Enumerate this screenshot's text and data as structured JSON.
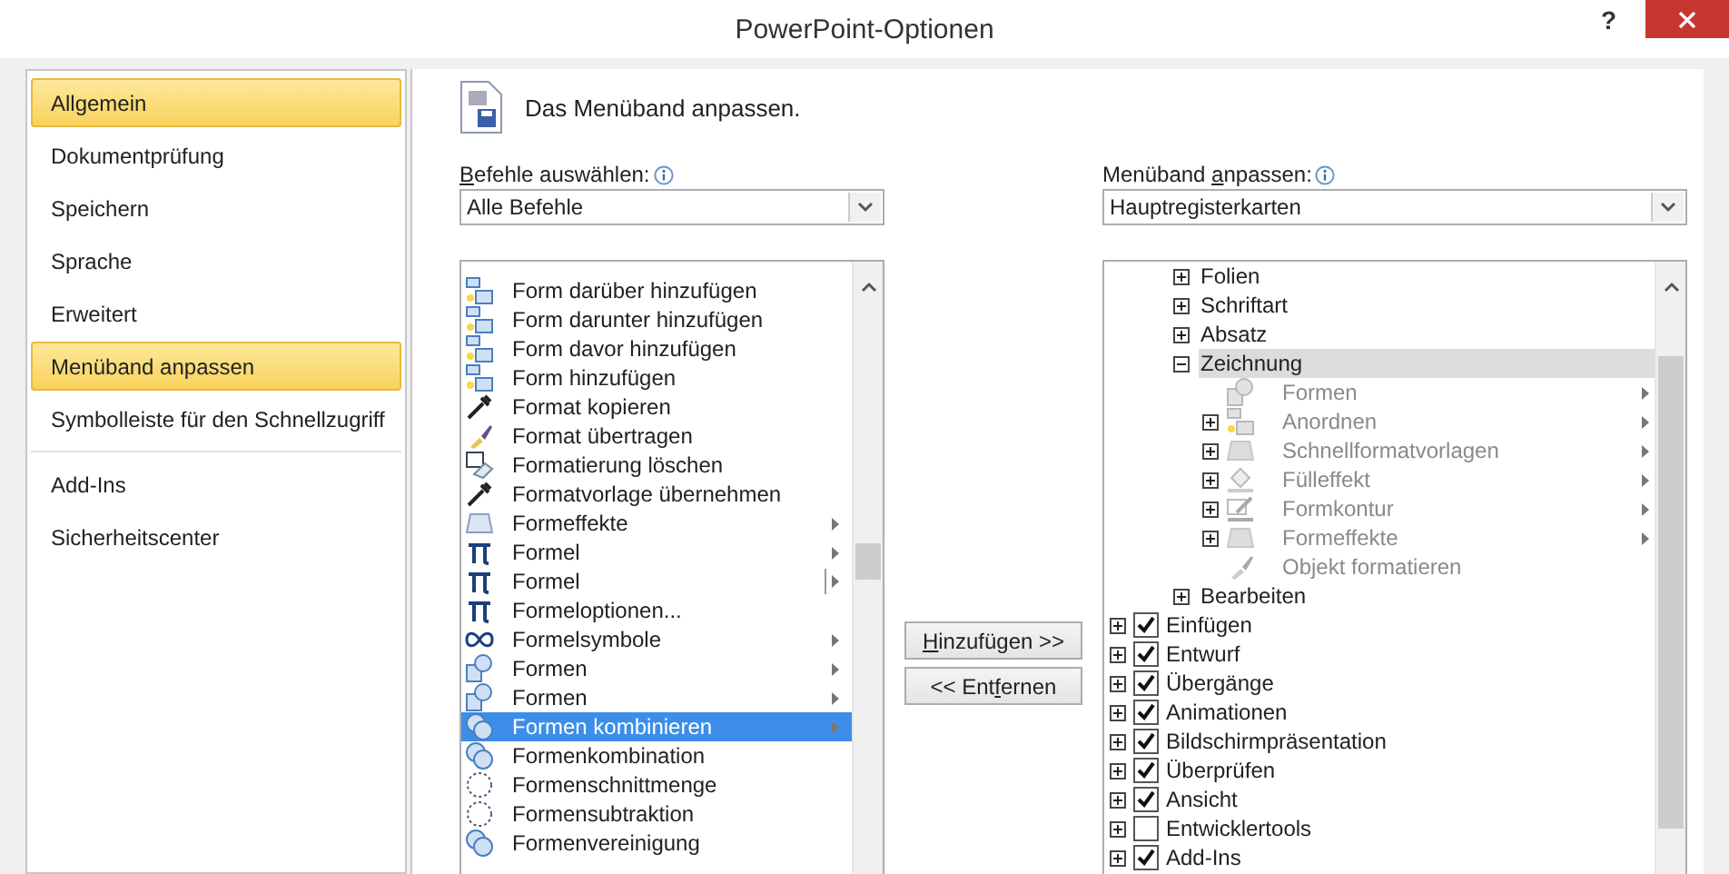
{
  "window": {
    "title": "PowerPoint-Optionen",
    "help_button": "?"
  },
  "sidebar": {
    "sections": [
      {
        "items": [
          {
            "label": "Allgemein",
            "selected": true
          },
          {
            "label": "Dokumentprüfung",
            "selected": false
          },
          {
            "label": "Speichern",
            "selected": false
          },
          {
            "label": "Sprache",
            "selected": false
          },
          {
            "label": "Erweitert",
            "selected": false
          },
          {
            "label": "Menüband anpassen",
            "selected": true
          },
          {
            "label": "Symbolleiste für den Schnellzugriff",
            "selected": false
          }
        ]
      },
      {
        "items": [
          {
            "label": "Add-Ins",
            "selected": false
          },
          {
            "label": "Sicherheitscenter",
            "selected": false
          }
        ]
      }
    ]
  },
  "heading": "Das Menüband anpassen.",
  "commands": {
    "label": {
      "key": "B",
      "after": "efehle auswählen:"
    },
    "dropdown": "Alle Befehle",
    "items": [
      {
        "label": "Form darüber hinzufügen",
        "kind": "command",
        "selected": false
      },
      {
        "label": "Form darunter hinzufügen",
        "kind": "command",
        "selected": false
      },
      {
        "label": "Form davor hinzufügen",
        "kind": "command",
        "selected": false
      },
      {
        "label": "Form hinzufügen",
        "kind": "command",
        "selected": false
      },
      {
        "label": "Format kopieren",
        "kind": "command",
        "selected": false
      },
      {
        "label": "Format übertragen",
        "kind": "command",
        "selected": false
      },
      {
        "label": "Formatierung löschen",
        "kind": "command",
        "selected": false
      },
      {
        "label": "Formatvorlage übernehmen",
        "kind": "command",
        "selected": false
      },
      {
        "label": "Formeffekte",
        "kind": "menu",
        "selected": false
      },
      {
        "label": "Formel",
        "kind": "menu",
        "selected": false
      },
      {
        "label": "Formel",
        "kind": "split",
        "selected": false
      },
      {
        "label": "Formeloptionen...",
        "kind": "command",
        "selected": false
      },
      {
        "label": "Formelsymbole",
        "kind": "menu",
        "selected": false
      },
      {
        "label": "Formen",
        "kind": "menu",
        "selected": false
      },
      {
        "label": "Formen",
        "kind": "menu",
        "selected": false
      },
      {
        "label": "Formen kombinieren",
        "kind": "menu",
        "selected": true
      },
      {
        "label": "Formenkombination",
        "kind": "command",
        "selected": false
      },
      {
        "label": "Formenschnittmenge",
        "kind": "command",
        "selected": false
      },
      {
        "label": "Formensubtraktion",
        "kind": "command",
        "selected": false
      },
      {
        "label": "Formenvereinigung",
        "kind": "command",
        "selected": false
      }
    ]
  },
  "buttons": [
    {
      "label": {
        "key": "H",
        "after": "inzufügen >>"
      }
    },
    {
      "label": {
        "before": "<< Ent",
        "key": "f",
        "after": "ernen"
      }
    }
  ],
  "ribbon": {
    "label": {
      "before": "Menüband ",
      "key": "a",
      "after": "npassen:"
    },
    "dropdown": "Hauptregisterkarten",
    "groups": [
      {
        "label": "Folien",
        "expanded": false,
        "selected": false
      },
      {
        "label": "Schriftart",
        "expanded": false,
        "selected": false
      },
      {
        "label": "Absatz",
        "expanded": false,
        "selected": false
      },
      {
        "label": "Zeichnung",
        "expanded": true,
        "selected": true,
        "children": [
          {
            "label": "Formen",
            "kind": "command",
            "submenu": true,
            "disabled": true
          },
          {
            "label": "Anordnen",
            "kind": "group",
            "submenu": true,
            "disabled": true
          },
          {
            "label": "Schnellformatvorlagen",
            "kind": "group",
            "submenu": true,
            "disabled": true
          },
          {
            "label": "Fülleffekt",
            "kind": "group",
            "submenu": true,
            "disabled": true
          },
          {
            "label": "Formkontur",
            "kind": "group",
            "submenu": true,
            "disabled": true
          },
          {
            "label": "Formeffekte",
            "kind": "group",
            "submenu": true,
            "disabled": true
          },
          {
            "label": "Objekt formatieren",
            "kind": "command",
            "submenu": false,
            "disabled": true
          }
        ]
      },
      {
        "label": "Bearbeiten",
        "expanded": false,
        "selected": false
      }
    ],
    "tabs": [
      {
        "label": "Einfügen",
        "checked": true,
        "expanded": false
      },
      {
        "label": "Entwurf",
        "checked": true,
        "expanded": false
      },
      {
        "label": "Übergänge",
        "checked": true,
        "expanded": false
      },
      {
        "label": "Animationen",
        "checked": true,
        "expanded": false
      },
      {
        "label": "Bildschirmpräsentation",
        "checked": true,
        "expanded": false
      },
      {
        "label": "Überprüfen",
        "checked": true,
        "expanded": false
      },
      {
        "label": "Ansicht",
        "checked": true,
        "expanded": false
      },
      {
        "label": "Entwicklertools",
        "checked": false,
        "expanded": false
      },
      {
        "label": "Add-Ins",
        "checked": true,
        "expanded": false
      }
    ]
  }
}
